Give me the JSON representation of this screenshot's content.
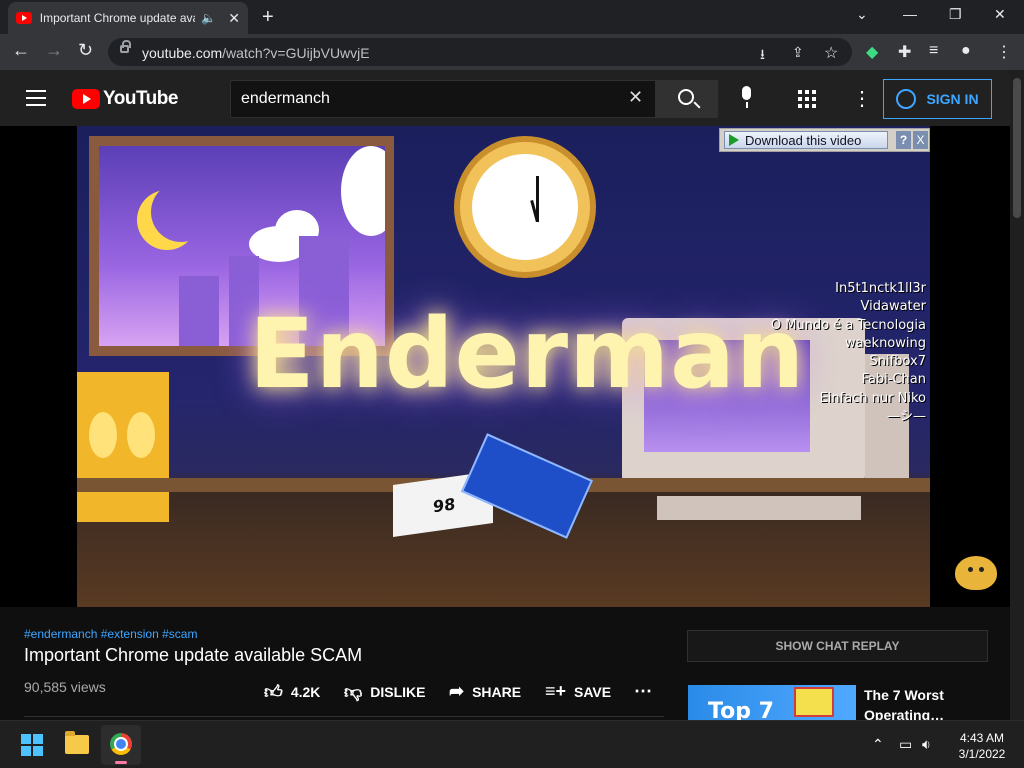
{
  "browser": {
    "tab_title": "Important Chrome update available SCAM",
    "audio_icon": "speaker-icon",
    "url_host": "youtube.com",
    "url_path": "/watch?v=GUijbVUwvjE"
  },
  "youtube": {
    "logo_text": "YouTube",
    "search_value": "endermanch",
    "sign_in_label": "SIGN IN",
    "accent_color": "#3ea6ff",
    "brand_color": "#ff0000"
  },
  "video": {
    "title_art": "Enderman",
    "box_label": "98",
    "download_label": "Download this video",
    "download_help": "?",
    "download_close": "X",
    "credits": [
      "In5t1nctk1ll3r",
      "Vidawater",
      "O Mundo é a Tecnologia",
      "waeknowing",
      "Snifbox7",
      "Fabi-Chan",
      "Einfach nur Niko",
      "—シ—"
    ]
  },
  "info": {
    "hashtags": "#endermanch #extension #scam",
    "title": "Important Chrome update available SCAM",
    "views": "90,585 views",
    "like_count": "4.2K",
    "dislike_label": "DISLIKE",
    "share_label": "SHARE",
    "save_label": "SAVE"
  },
  "sidebar": {
    "chat_replay_label": "SHOW CHAT REPLAY",
    "rec_thumb_text": "Top 7",
    "rec_title": "The 7 Worst Operating…"
  },
  "taskbar": {
    "time": "4:43 AM",
    "date": "3/1/2022"
  }
}
